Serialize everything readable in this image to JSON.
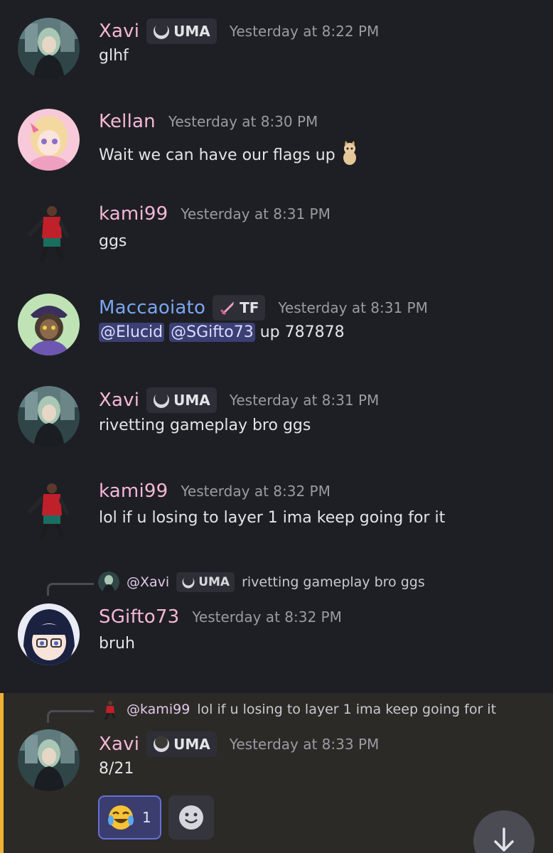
{
  "colors": {
    "background": "#1e1f24",
    "username_pink": "#f5b8d6",
    "username_blue": "#79a6f2",
    "timestamp": "#9a9ba3",
    "mention_bg": "#3b3f73",
    "highlight_border": "#f0b232"
  },
  "messages": [
    {
      "user": "Xavi",
      "tag": "UMA",
      "tag_icon": "moon-icon",
      "time": "Yesterday at 8:22 PM",
      "text": "glhf"
    },
    {
      "user": "Kellan",
      "time": "Yesterday at 8:30 PM",
      "text": "Wait we can have our flags up",
      "emoji": "cat-sticker-icon"
    },
    {
      "user": "kami99",
      "time": "Yesterday at 8:31 PM",
      "text": "ggs"
    },
    {
      "user": "Maccaoiato",
      "tag": "TF",
      "tag_icon": "sword-icon",
      "time": "Yesterday at 8:31 PM",
      "mentions": [
        "@Elucid",
        "@SGifto73"
      ],
      "text": "up 787878"
    },
    {
      "user": "Xavi",
      "tag": "UMA",
      "tag_icon": "moon-icon",
      "time": "Yesterday at 8:31 PM",
      "text": "rivetting gameplay bro ggs"
    },
    {
      "user": "kami99",
      "time": "Yesterday at 8:32 PM",
      "text": "lol if u losing to layer 1 ima keep going for it"
    },
    {
      "reply": {
        "user": "@Xavi",
        "tag": "UMA",
        "text": "rivetting gameplay bro ggs"
      },
      "user": "SGifto73",
      "time": "Yesterday at 8:32 PM",
      "text": "bruh"
    },
    {
      "reply": {
        "user": "@kami99",
        "text": "lol if u losing to layer 1 ima keep going for it"
      },
      "user": "Xavi",
      "tag": "UMA",
      "tag_icon": "moon-icon",
      "time": "Yesterday at 8:33 PM",
      "text": "8/21",
      "reactions": [
        {
          "emoji": "joy-emoji-icon",
          "count": "1"
        }
      ]
    }
  ]
}
